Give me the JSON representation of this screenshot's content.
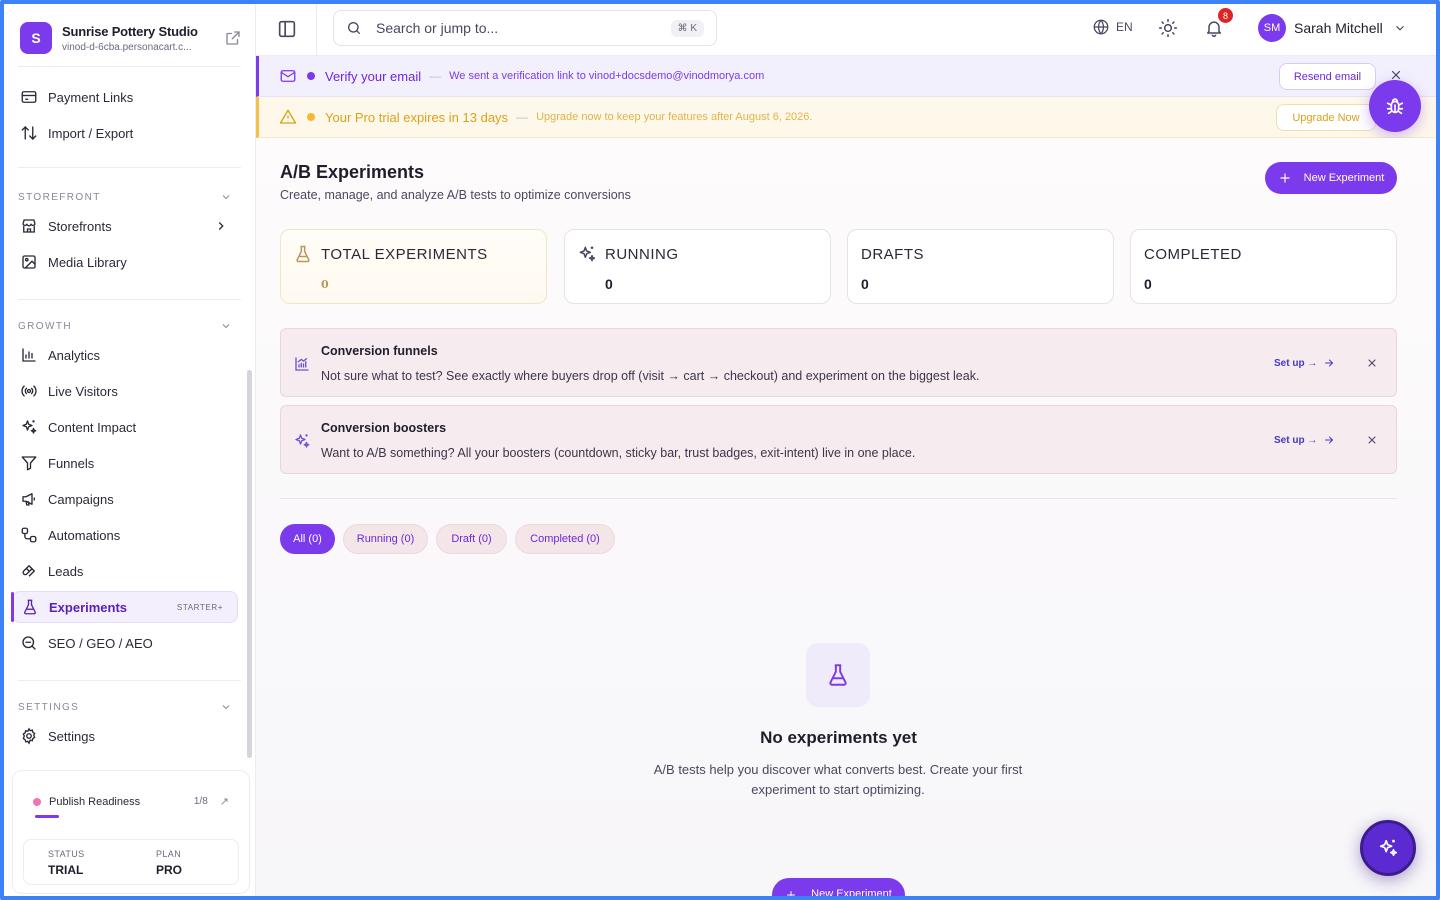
{
  "brand": {
    "initial": "S",
    "name": "Sunrise Pottery Studio",
    "url": "vinod-d-6cba.personacart.c..."
  },
  "sidebar": {
    "top_items": [
      {
        "label": "Payment Links",
        "icon": "credit-card-icon"
      },
      {
        "label": "Import / Export",
        "icon": "arrows-up-down-icon"
      }
    ],
    "sections": {
      "storefront": "STOREFRONT",
      "growth": "GROWTH",
      "settings": "SETTINGS"
    },
    "storefront_items": [
      {
        "label": "Storefronts",
        "icon": "store-icon"
      },
      {
        "label": "Media Library",
        "icon": "image-icon"
      }
    ],
    "growth_items": [
      {
        "label": "Analytics",
        "icon": "bar-chart-icon"
      },
      {
        "label": "Live Visitors",
        "icon": "broadcast-icon"
      },
      {
        "label": "Content Impact",
        "icon": "sparkles-icon"
      },
      {
        "label": "Funnels",
        "icon": "funnel-icon"
      },
      {
        "label": "Campaigns",
        "icon": "megaphone-icon"
      },
      {
        "label": "Automations",
        "icon": "workflow-icon"
      },
      {
        "label": "Leads",
        "icon": "magnet-icon"
      },
      {
        "label": "Experiments",
        "icon": "flask-icon",
        "badge": "STARTER+",
        "active": true
      },
      {
        "label": "SEO / GEO / AEO",
        "icon": "search-zoom-icon"
      }
    ],
    "settings_items": [
      {
        "label": "Settings",
        "icon": "gear-icon"
      }
    ],
    "readiness": {
      "label": "Publish Readiness",
      "count": "1/8",
      "progress": 0.125,
      "status_key": "STATUS",
      "status_value": "TRIAL",
      "plan_key": "PLAN",
      "plan_value": "PRO"
    }
  },
  "topbar": {
    "search_placeholder": "Search or jump to...",
    "shortcut": "⌘ K",
    "language": "EN",
    "notifications_count": "8",
    "user_initials": "SM",
    "user_name": "Sarah Mitchell"
  },
  "banners": {
    "verify": {
      "title": "Verify your email",
      "dash": "—",
      "desc": "We sent a verification link to vinod+docsdemo@vinodmorya.com",
      "button": "Resend email",
      "color": "#7c3aed"
    },
    "trial": {
      "title": "Your Pro trial expires in 13 days",
      "dash": "—",
      "desc": "Upgrade now to keep your features after August 6, 2026.",
      "button": "Upgrade Now",
      "color": "#d9a21b"
    }
  },
  "page": {
    "title": "A/B Experiments",
    "subtitle": "Create, manage, and analyze A/B tests to optimize conversions",
    "new_button": "New Experiment"
  },
  "stats": [
    {
      "label": "TOTAL EXPERIMENTS",
      "value": "0",
      "icon": "flask-icon"
    },
    {
      "label": "RUNNING",
      "value": "0",
      "icon": "sparkles-icon"
    },
    {
      "label": "DRAFTS",
      "value": "0",
      "icon": ""
    },
    {
      "label": "COMPLETED",
      "value": "0",
      "icon": ""
    }
  ],
  "promos": [
    {
      "title": "Conversion funnels",
      "desc": "Not sure what to test? See exactly where buyers drop off (visit → cart → checkout) and experiment on the biggest leak.",
      "link": "Set up →",
      "icon": "bar-chart-icon"
    },
    {
      "title": "Conversion boosters",
      "desc": "Want to A/B something? All your boosters (countdown, sticky bar, trust badges, exit-intent) live in one place.",
      "link": "Set up →",
      "icon": "sparkles-icon"
    }
  ],
  "filters": [
    {
      "label": "All (0)",
      "active": true
    },
    {
      "label": "Running (0)",
      "active": false
    },
    {
      "label": "Draft (0)",
      "active": false
    },
    {
      "label": "Completed (0)",
      "active": false
    }
  ],
  "empty": {
    "title": "No experiments yet",
    "desc": "A/B tests help you discover what converts best. Create your first experiment to start optimizing.",
    "button": "New Experiment"
  },
  "colors": {
    "accent": "#7c3aed",
    "warning": "#f5c04a",
    "notification": "#dc2626"
  }
}
